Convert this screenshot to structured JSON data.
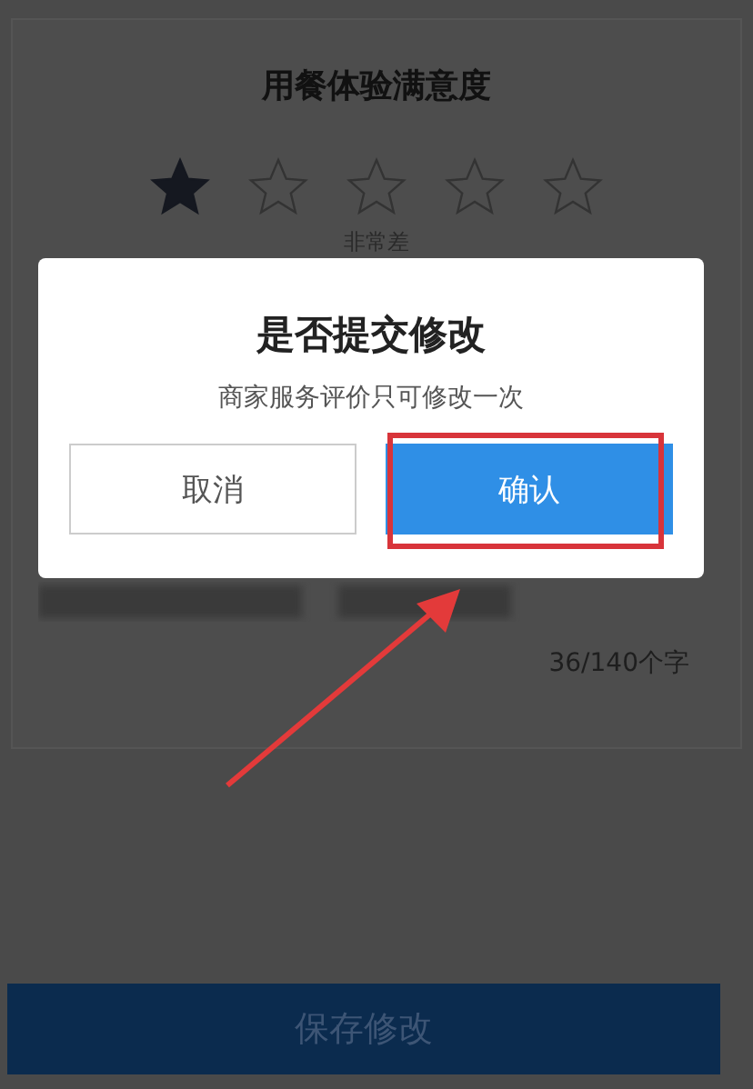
{
  "rating": {
    "title": "用餐体验满意度",
    "stars": 1,
    "caption": "非常差"
  },
  "comment": {
    "count": "36/140个字"
  },
  "save_button": {
    "label": "保存修改"
  },
  "dialog": {
    "title": "是否提交修改",
    "message": "商家服务评价只可修改一次",
    "buttons": [
      {
        "label": "取消",
        "kind": "secondary"
      },
      {
        "label": "确认",
        "kind": "primary"
      }
    ]
  }
}
